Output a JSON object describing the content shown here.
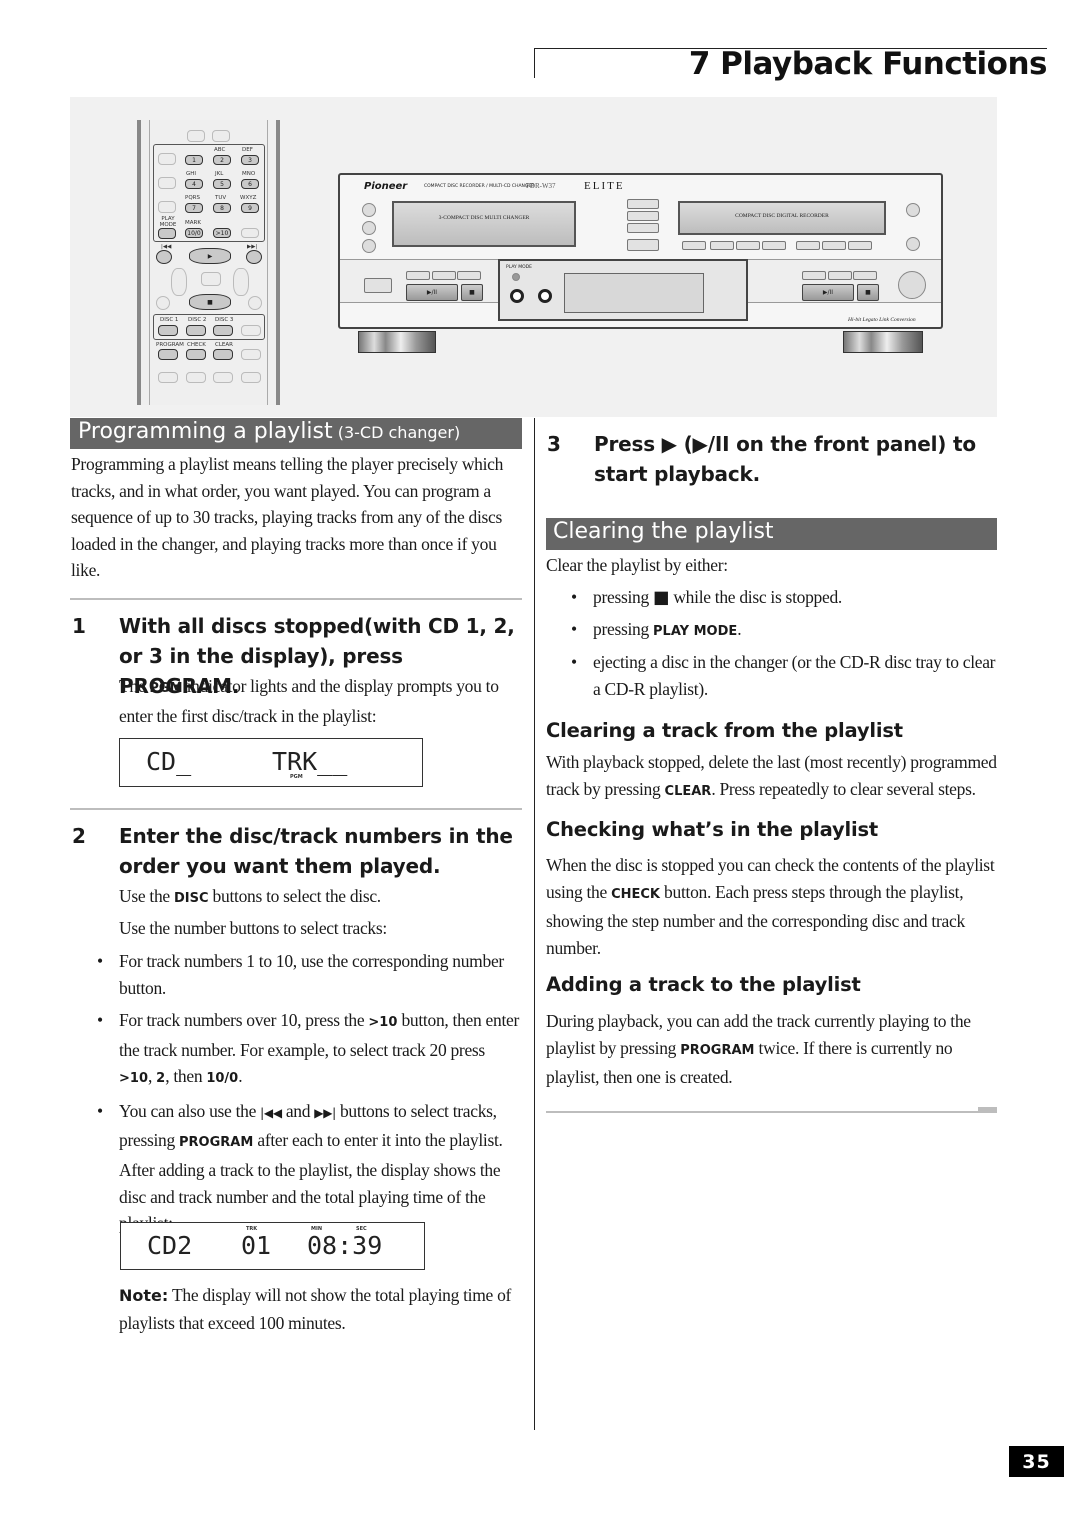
{
  "header": {
    "chapter_title": "7 Playback Functions"
  },
  "illustration": {
    "remote": {
      "keypad_letters": [
        "ABC",
        "DEF",
        "GHI",
        "JKL",
        "MNO",
        "PQRS",
        "TUV",
        "WXYZ"
      ],
      "number_keys": [
        "1",
        "2",
        "3",
        "4",
        "5",
        "6",
        "7",
        "8",
        "9",
        "10/0",
        ">10"
      ],
      "play_mode_label": "PLAY MODE",
      "mark_label": "MARK",
      "prev_icon": "|◀◀",
      "next_icon": "▶▶|",
      "play_icon": "▶",
      "stop_icon": "■",
      "disc_buttons": [
        "DISC 1",
        "DISC 2",
        "DISC 3"
      ],
      "function_buttons": [
        "PROGRAM",
        "CHECK",
        "CLEAR"
      ]
    },
    "recorder": {
      "brand": "Pioneer",
      "model_line": "COMPACT DISC RECORDER / MULTI-CD CHANGER",
      "model": "PDR-W37",
      "series": "ELITE",
      "changer_tray_label": "3-COMPACT DISC MULTI CHANGER",
      "recorder_tray_label": "COMPACT DISC DIGITAL RECORDER",
      "play_mode_label": "PLAY MODE",
      "play_pause_icon": "▶/II",
      "stop_icon": "■",
      "footer_badge": "Hi-bit Legato Link Conversion"
    }
  },
  "left": {
    "section": {
      "title": "Programming a playlist",
      "subtitle": "(3-CD changer)"
    },
    "intro": "Programming a playlist means telling the player precisely which tracks, and in what order, you want played. You can program a sequence of up to 30 tracks, playing tracks from any of the discs loaded in the changer, and playing tracks more than once if you like.",
    "step1": {
      "number": "1",
      "heading_line1": "With all discs stopped(with CD 1, 2,",
      "heading_line2": "or 3 in the display), press PROGRAM.",
      "text_pre": "The ",
      "text_bold": "PGM",
      "text_post": " indicator lights and the display prompts you to enter the first disc/track in the playlist:",
      "display": {
        "disc": "CD_",
        "track": "TRK__",
        "indicator": "PGM"
      }
    },
    "step2": {
      "number": "2",
      "heading_line1": "Enter the disc/track numbers in the",
      "heading_line2": "order you want them played.",
      "line1_pre": "Use the ",
      "line1_bold": "DISC",
      "line1_post": " buttons to select the disc.",
      "line2": "Use the number buttons to select tracks:",
      "bullet1": "For track numbers 1 to 10, use the corresponding number button.",
      "bullet2_pre": "For track numbers over 10, press the ",
      "bullet2_bold": ">10",
      "bullet2_post": " button, then enter the track number. For example, to select track 20 press",
      "bullet2_example": {
        "a": ">10",
        "sep1": ", ",
        "b": "2",
        "sep2": ", then ",
        "c": "10/0",
        "end": "."
      },
      "bullet3_pre": "You can also use the ",
      "bullet3_prev": "|◀◀",
      "bullet3_and": " and ",
      "bullet3_next": "▶▶|",
      "bullet3_mid": " buttons to select tracks, pressing ",
      "bullet3_bold": "PROGRAM",
      "bullet3_post": " after each to enter it into the playlist.",
      "after_text": "After adding a track to the playlist, the display shows the disc and track number and the total playing time of the playlist:",
      "display": {
        "disc": "CD2",
        "track": "01",
        "time": "08:39",
        "trk_label": "TRK",
        "min_label": "MIN",
        "sec_label": "SEC"
      }
    },
    "note": {
      "label": "Note:",
      "text": " The display will not show the total playing time of playlists that exceed 100 minutes."
    }
  },
  "right": {
    "step3": {
      "number": "3",
      "heading_line1": "Press ▶ (▶/II on the front panel) to",
      "heading_line2": "start playback."
    },
    "clearing": {
      "title": "Clearing the playlist",
      "intro": "Clear the playlist by either:",
      "bullet1_pre": "pressing ",
      "bullet1_icon": "■",
      "bullet1_post": " while the disc is stopped.",
      "bullet2_pre": "pressing ",
      "bullet2_bold": "PLAY MODE",
      "bullet2_post": ".",
      "bullet3": "ejecting a disc in the changer (or the CD-R disc tray to clear a CD-R playlist)."
    },
    "clear_track": {
      "title": "Clearing a track from the playlist",
      "text_pre": "With playback stopped, delete the last (most recently) programmed track by pressing ",
      "text_bold": "CLEAR",
      "text_post": ". Press repeatedly to clear several steps."
    },
    "checking": {
      "title": "Checking what’s in the playlist",
      "text_pre": "When the disc is stopped you can check the contents of the playlist using the ",
      "text_bold": "CHECK",
      "text_post": " button. Each press steps through the playlist, showing the step number and the corresponding disc and track number."
    },
    "adding": {
      "title": "Adding a track to the playlist",
      "text_pre": "During playback, you can add the track currently playing to the playlist by pressing ",
      "text_bold": "PROGRAM",
      "text_post": " twice. If there is currently no playlist, then one is created."
    }
  },
  "footer": {
    "page_number": "35"
  }
}
